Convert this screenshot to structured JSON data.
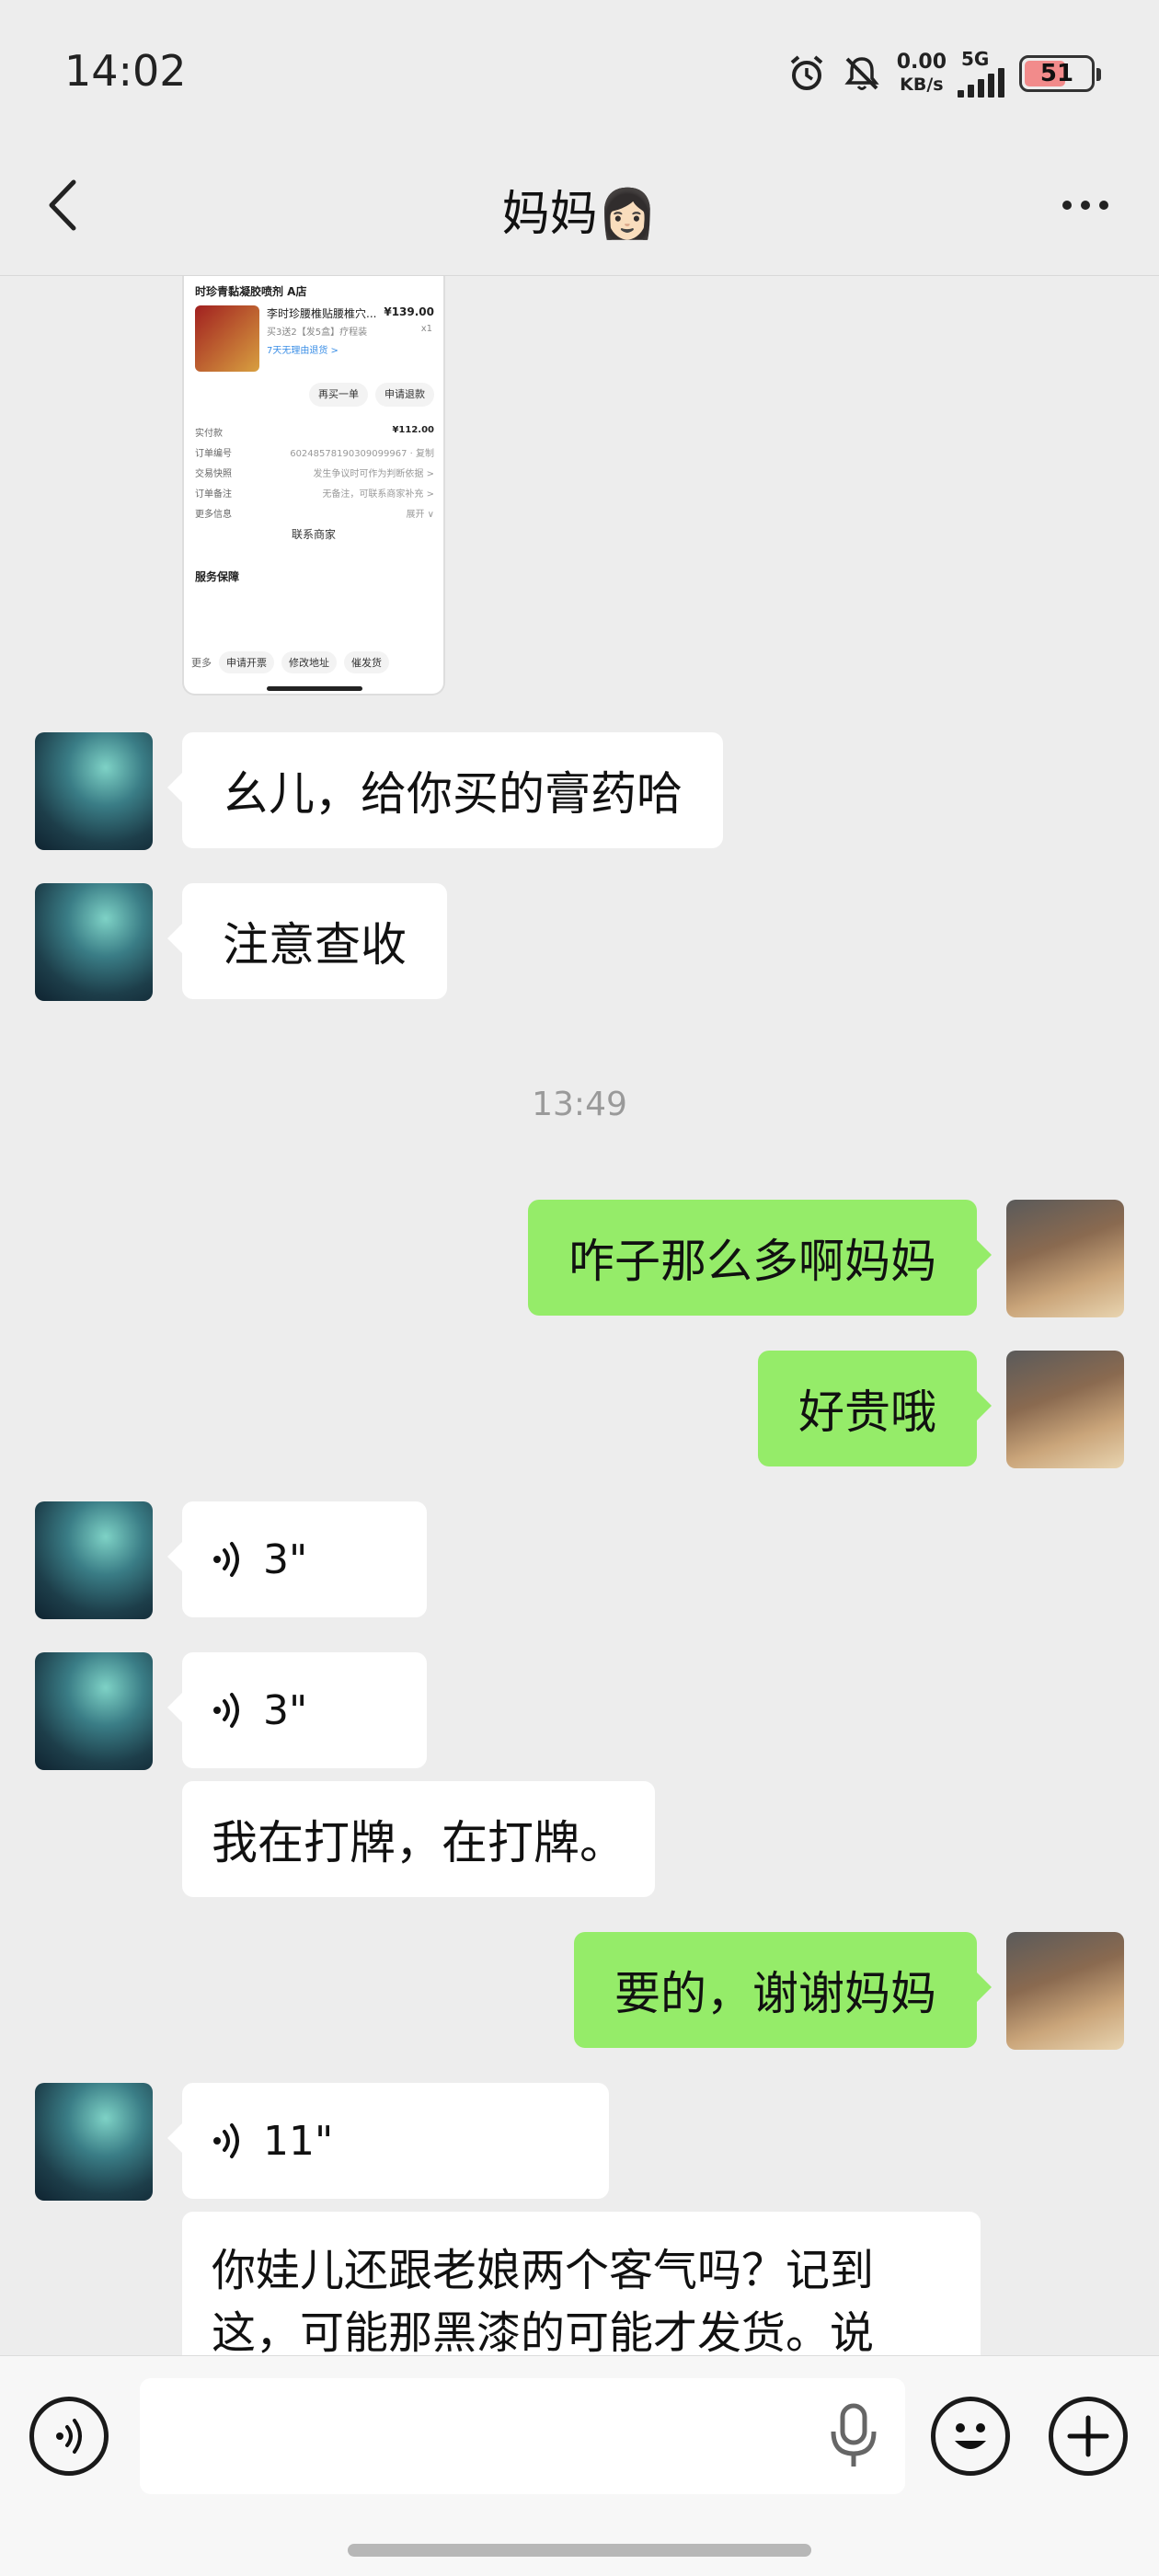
{
  "status_bar": {
    "time": "14:02",
    "net_speed_value": "0.00",
    "net_speed_unit": "KB/s",
    "network_type": "5G",
    "battery_level": "51",
    "icons": [
      "alarm-icon",
      "mute-bell-icon",
      "signal-icon",
      "battery-icon"
    ]
  },
  "header": {
    "title": "妈妈👩🏻"
  },
  "shared_screenshot": {
    "shop_name": "时珍青黏凝胶喷剂 A店",
    "product_name": "李时珍腰椎贴腰椎穴...",
    "price": "¥139.00",
    "spec": "买3送2【发5盒】疗程装",
    "qty": "x1",
    "tag": "7天无理由退货 >",
    "btn_buy_again": "再买一单",
    "btn_refund": "申请退款",
    "paid_label": "实付款",
    "paid_value": "¥112.00",
    "row_order_no": "订单编号",
    "row_order_no_val": "60248578190309099967 · 复制",
    "row_trade": "交易快照",
    "row_trade_val": "发生争议时可作为判断依据 >",
    "row_remark": "订单备注",
    "row_remark_val": "无备注，可联系商家补充 >",
    "row_more": "更多信息",
    "row_more_val": "展开 ∨",
    "contact": "联系商家",
    "service_title": "服务保障",
    "bottom_more": "更多",
    "bottom_invoice": "申请开票",
    "bottom_address": "修改地址",
    "bottom_urge": "催发货"
  },
  "messages": {
    "m1": "幺儿，给你买的膏药哈",
    "m2": "注意查收",
    "time1": "13:49",
    "m3": "咋子那么多啊妈妈",
    "m4": "好贵哦",
    "v1": "3\"",
    "v2": "3\"",
    "m5": "我在打牌，在打牌。",
    "m6": "要的，谢谢妈妈",
    "v3": "11\"",
    "m7": "你娃儿还跟老娘两个客气吗？记到这，可能那黑漆的可能才发货。说"
  },
  "input_bar": {
    "placeholder": "",
    "icons": [
      "voice-icon",
      "microphone-icon",
      "emoji-icon",
      "plus-icon"
    ]
  }
}
